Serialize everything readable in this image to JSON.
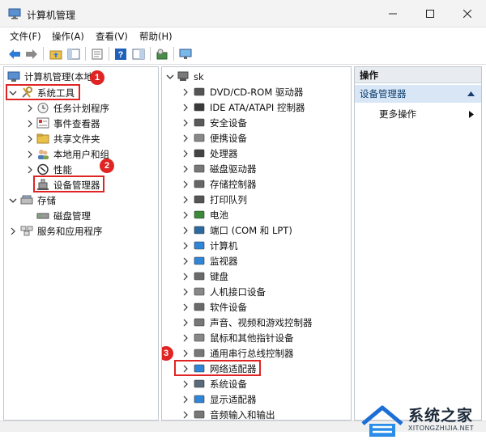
{
  "window": {
    "title": "计算机管理"
  },
  "menu": [
    "文件(F)",
    "操作(A)",
    "查看(V)",
    "帮助(H)"
  ],
  "left_tree": {
    "root_label": "计算机管理(本地",
    "system_tools_label": "系统工具",
    "items": [
      "任务计划程序",
      "事件查看器",
      "共享文件夹",
      "本地用户和组",
      "性能",
      "设备管理器"
    ],
    "storage_label": "存储",
    "disk_label": "磁盘管理",
    "services_label": "服务和应用程序"
  },
  "device_tree": {
    "root_label": "sk",
    "items": [
      "DVD/CD-ROM 驱动器",
      "IDE ATA/ATAPI 控制器",
      "安全设备",
      "便携设备",
      "处理器",
      "磁盘驱动器",
      "存储控制器",
      "打印队列",
      "电池",
      "端口 (COM 和 LPT)",
      "计算机",
      "监视器",
      "键盘",
      "人机接口设备",
      "软件设备",
      "声音、视频和游戏控制器",
      "鼠标和其他指针设备",
      "通用串行总线控制器",
      "网络适配器",
      "系统设备",
      "显示适配器",
      "音频输入和输出"
    ]
  },
  "actions": {
    "header": "操作",
    "section": "设备管理器",
    "more": "更多操作"
  },
  "badges": [
    "1",
    "2",
    "3"
  ],
  "watermark": {
    "name": "系统之家",
    "url": "XITONGZHIJIA.NET"
  },
  "colors": {
    "highlight_red": "#e02424",
    "selection_blue": "#d9e6f6"
  }
}
